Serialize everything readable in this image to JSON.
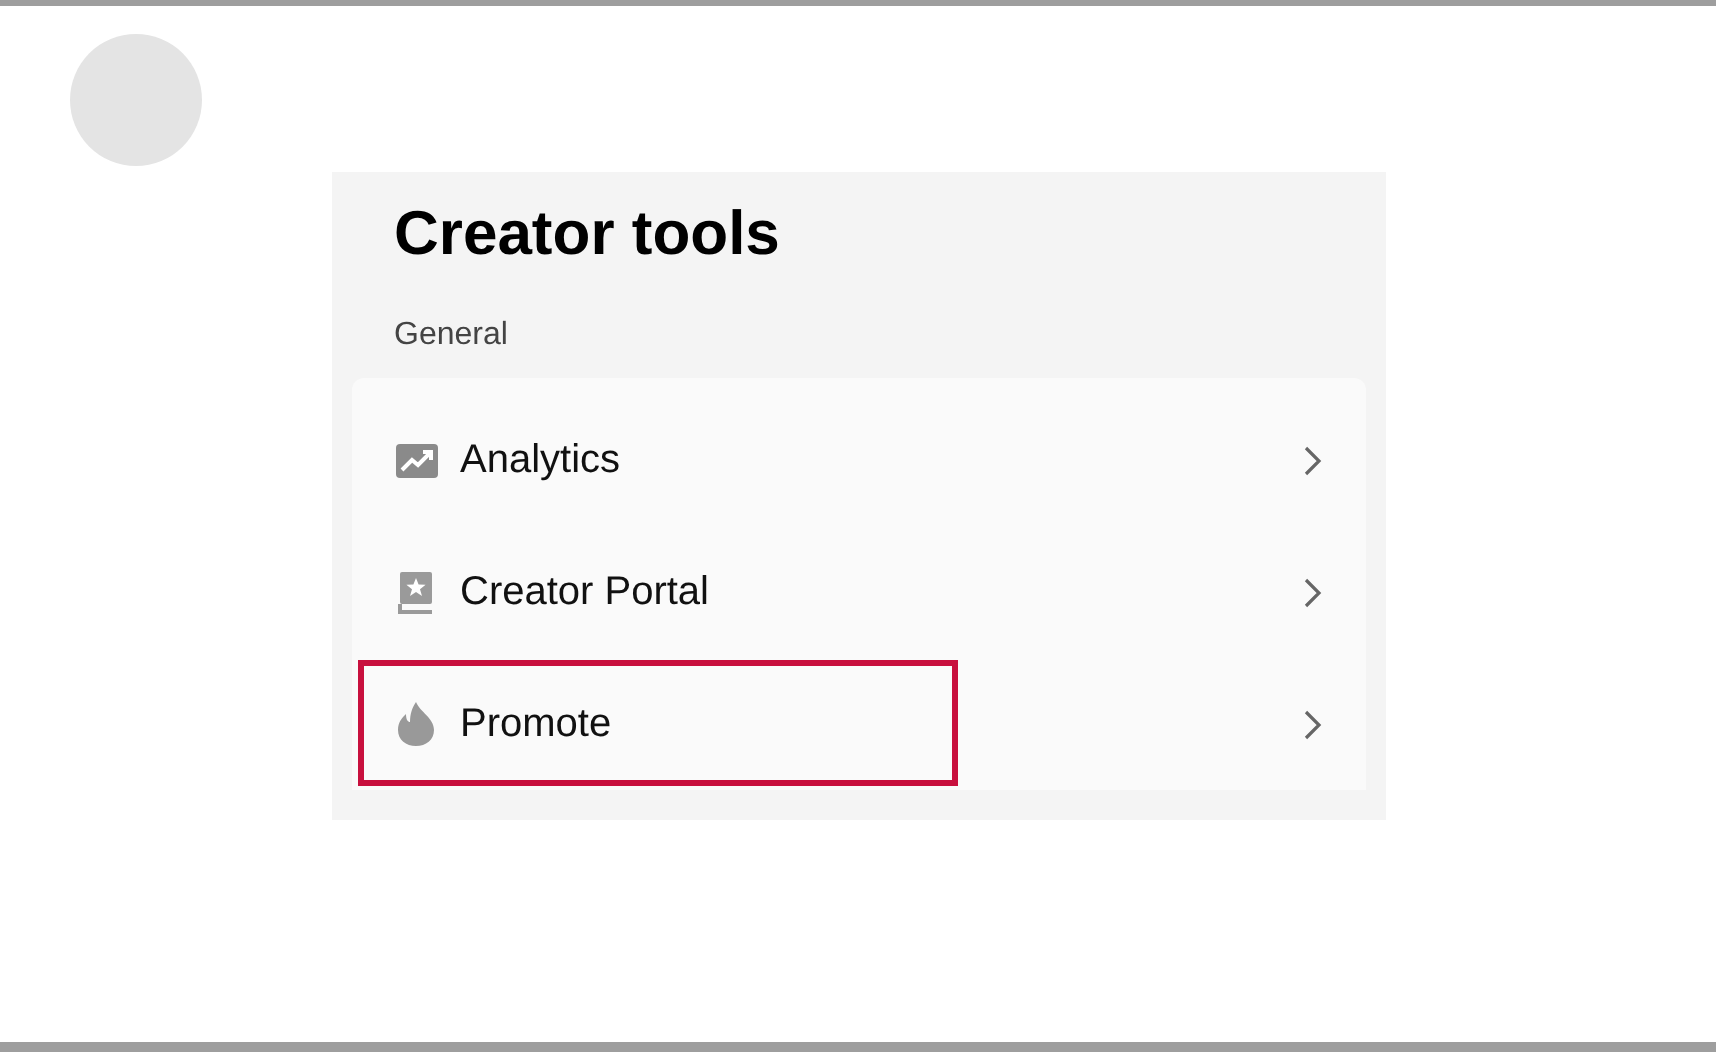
{
  "title": "Creator tools",
  "section": "General",
  "items": [
    {
      "kind": "analytics",
      "label": "Analytics",
      "highlighted": false
    },
    {
      "kind": "portal",
      "label": "Creator Portal",
      "highlighted": false
    },
    {
      "kind": "promote",
      "label": "Promote",
      "highlighted": true
    }
  ]
}
